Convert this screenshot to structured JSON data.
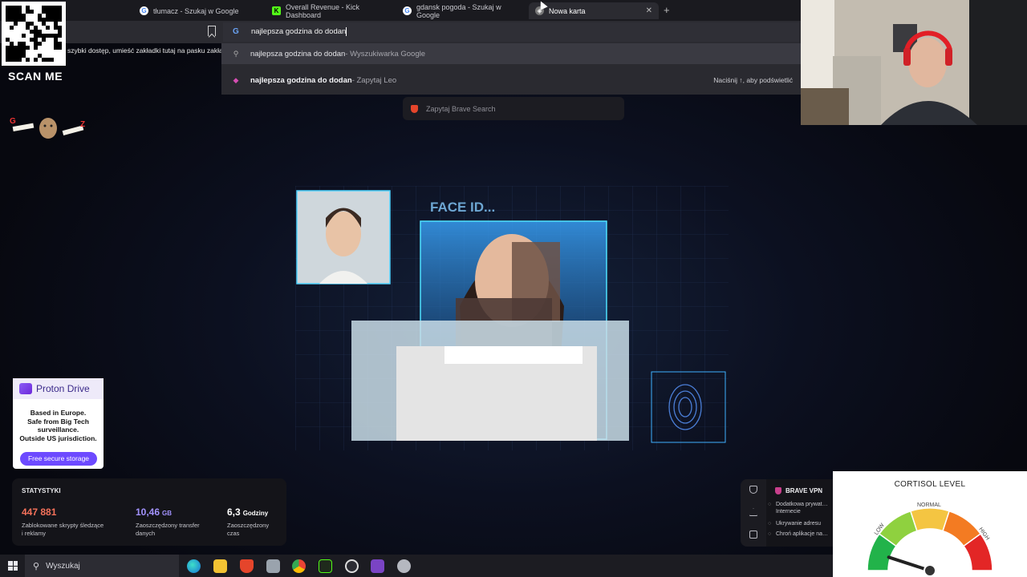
{
  "browser": {
    "tabs": [
      {
        "label": "tłumacz - Szukaj w Google",
        "favicon": "google-icon"
      },
      {
        "label": "Overall Revenue - Kick Dashboard",
        "favicon": "kick-icon"
      },
      {
        "label": "gdansk pogoda - Szukaj w Google",
        "favicon": "google-icon"
      },
      {
        "label": "Nowa karta",
        "favicon": "brave-icon",
        "active": true
      }
    ],
    "new_tab": "+",
    "close_tab": "✕",
    "omnibox_value": "najlepsza godzina do dodan",
    "bookmarks_hint": "szybki dostęp, umieść zakładki tutaj na pasku zakładek",
    "suggestions": [
      {
        "bold": "najlepsza godzina do dodan",
        "suffix": " - Wyszukiwarka Google",
        "icon": "search-icon"
      },
      {
        "bold": "najlepsza godzina do dodan",
        "suffix": " - Zapytaj Leo",
        "icon": "leo-icon",
        "hint": "Naciśnij ↑, aby podświetlić"
      }
    ],
    "brave_search_placeholder": "Zapytaj Brave Search"
  },
  "overlay": {
    "scan_me": "SCAN ME"
  },
  "hero": {
    "face_id_text": "FACE ID..."
  },
  "proton": {
    "brand": "Proton Drive",
    "text_lines": [
      "Based in Europe.",
      "Safe from Big Tech",
      "surveillance.",
      "Outside US jurisdiction."
    ],
    "button": "Free secure storage"
  },
  "stats": {
    "title": "STATYSTYKI",
    "items": [
      {
        "value": "447 881",
        "unit": "",
        "desc": "Zablokowane skrypty śledzące i reklamy",
        "color": "#f5715a"
      },
      {
        "value": "10,46",
        "unit": "GB",
        "desc": "Zaoszczędzony transfer danych",
        "color": "#a393ff"
      },
      {
        "value": "6,3",
        "unit": "Godziny",
        "desc": "Zaoszczędzony czas",
        "color": "#ffffff"
      }
    ]
  },
  "vpn": {
    "title": "BRAVE VPN",
    "items": [
      "Dodatkowa prywat… Internecie",
      "Ukrywanie adresu",
      "Chroń aplikacje na…"
    ]
  },
  "cortisol": {
    "title": "CORTISOL LEVEL",
    "labels": [
      "LOW",
      "NORMAL",
      "HIGH"
    ],
    "level": 0.1
  },
  "taskbar": {
    "search_placeholder": "Wyszukaj"
  }
}
